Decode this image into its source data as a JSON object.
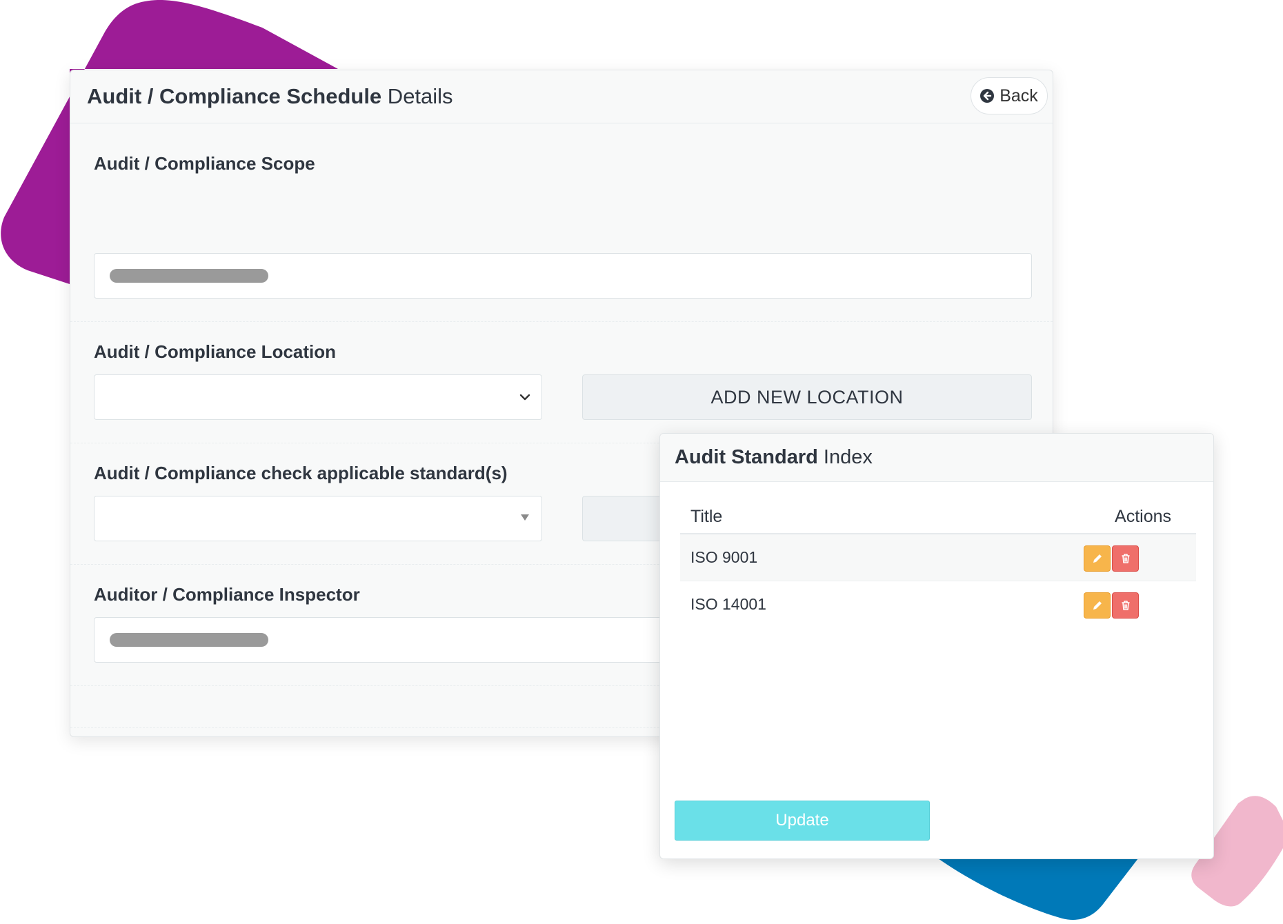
{
  "colors": {
    "purple_blob": "#9d1c96",
    "blue_blob": "#0079b8",
    "pink_blob": "#f1b7cc",
    "edit_button": "#f7b54b",
    "delete_button": "#ef6f6a",
    "update_button": "#6ae0e8"
  },
  "main": {
    "title_bold": "Audit / Compliance Schedule",
    "title_rest": " Details",
    "back_label": "Back",
    "back_icon": "arrow-circle-left-icon",
    "scope": {
      "label": "Audit / Compliance Scope"
    },
    "location": {
      "label": "Audit / Compliance Location",
      "add_button": "ADD NEW LOCATION"
    },
    "standards": {
      "label": "Audit / Compliance check applicable standard(s)"
    },
    "inspector": {
      "label": "Auditor / Compliance Inspector"
    }
  },
  "modal": {
    "title_bold": "Audit Standard",
    "title_rest": " Index",
    "columns": {
      "title": "Title",
      "actions": "Actions"
    },
    "rows": [
      {
        "title": "ISO 9001"
      },
      {
        "title": "ISO 14001"
      }
    ],
    "edit_icon": "pencil-icon",
    "delete_icon": "trash-icon",
    "update_label": "Update"
  }
}
